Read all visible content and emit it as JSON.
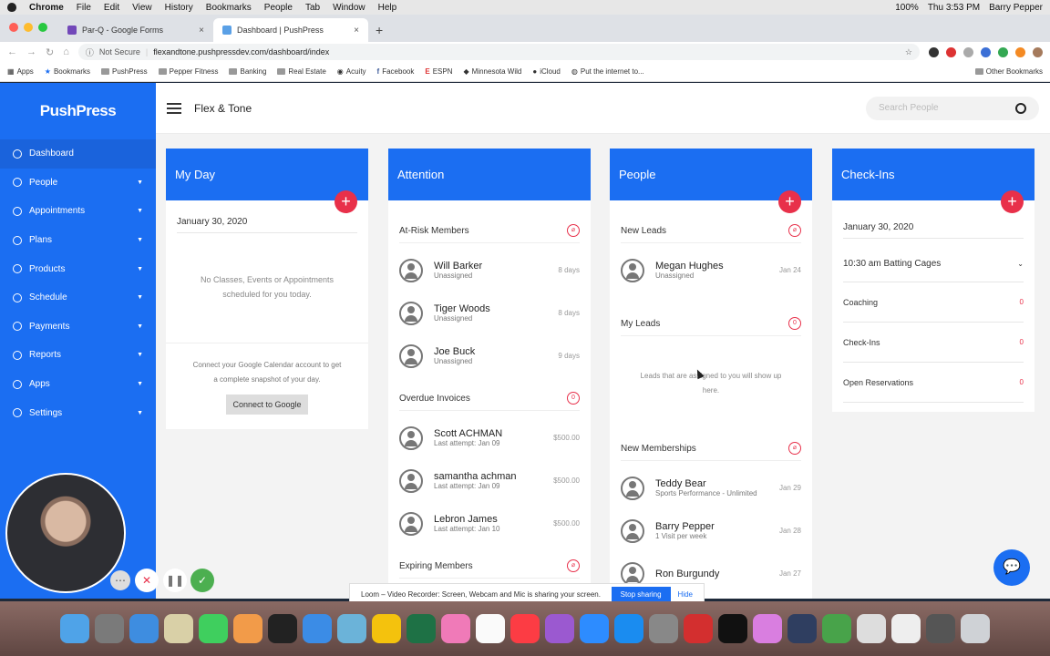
{
  "mac_menu": {
    "app": "Chrome",
    "items": [
      "File",
      "Edit",
      "View",
      "History",
      "Bookmarks",
      "People",
      "Tab",
      "Window",
      "Help"
    ],
    "battery": "100%",
    "clock": "Thu 3:53 PM",
    "user": "Barry Pepper"
  },
  "tabs": [
    {
      "label": "Par-Q - Google Forms"
    },
    {
      "label": "Dashboard | PushPress"
    }
  ],
  "address": {
    "security": "Not Secure",
    "url": "flexandtone.pushpressdev.com/dashboard/index"
  },
  "bookmarks": [
    "Apps",
    "Bookmarks",
    "PushPress",
    "Pepper Fitness",
    "Banking",
    "Real Estate",
    "Acuity",
    "Facebook",
    "ESPN",
    "Minnesota Wild",
    "iCloud",
    "Put the internet to...",
    "Other Bookmarks"
  ],
  "sidebar": {
    "logo": "PushPress",
    "items": [
      {
        "label": "Dashboard"
      },
      {
        "label": "People"
      },
      {
        "label": "Appointments"
      },
      {
        "label": "Plans"
      },
      {
        "label": "Products"
      },
      {
        "label": "Schedule"
      },
      {
        "label": "Payments"
      },
      {
        "label": "Reports"
      },
      {
        "label": "Apps"
      },
      {
        "label": "Settings"
      }
    ]
  },
  "topbar": {
    "gym": "Flex & Tone",
    "search_placeholder": "Search People"
  },
  "myday": {
    "title": "My Day",
    "date": "January 30, 2020",
    "empty_1": "No Classes, Events or Appointments",
    "empty_2": "scheduled for you today.",
    "google_1": "Connect your Google Calendar account to get",
    "google_2": "a complete snapshot of your day.",
    "google_btn": "Connect to Google"
  },
  "attention": {
    "title": "Attention",
    "atrisk_title": "At-Risk Members",
    "atrisk": [
      {
        "name": "Will Barker",
        "sub": "Unassigned",
        "val": "8 days"
      },
      {
        "name": "Tiger Woods",
        "sub": "Unassigned",
        "val": "8 days"
      },
      {
        "name": "Joe Buck",
        "sub": "Unassigned",
        "val": "9 days"
      }
    ],
    "overdue_title": "Overdue Invoices",
    "overdue_count": "0",
    "overdue": [
      {
        "name": "Scott ACHMAN",
        "sub": "Last attempt: Jan 09",
        "val": "$500.00"
      },
      {
        "name": "samantha achman",
        "sub": "Last attempt: Jan 09",
        "val": "$500.00"
      },
      {
        "name": "Lebron James",
        "sub": "Last attempt: Jan 10",
        "val": "$500.00"
      }
    ],
    "expiring_title": "Expiring Members"
  },
  "people": {
    "title": "People",
    "leads_title": "New Leads",
    "leads": [
      {
        "name": "Megan Hughes",
        "sub": "Unassigned",
        "val": "Jan 24"
      }
    ],
    "myleads_title": "My Leads",
    "myleads_count": "0",
    "myleads_empty_1": "Leads that are assigned to you will show up",
    "myleads_empty_2": "here.",
    "memberships_title": "New Memberships",
    "memberships": [
      {
        "name": "Teddy Bear",
        "sub": "Sports Performance - Unlimited",
        "val": "Jan 29"
      },
      {
        "name": "Barry Pepper",
        "sub": "1 Visit per week",
        "val": "Jan 28"
      },
      {
        "name": "Ron Burgundy",
        "sub": "",
        "val": "Jan 27"
      }
    ]
  },
  "checkins": {
    "title": "Check-Ins",
    "date": "January 30, 2020",
    "class": "10:30 am Batting Cages",
    "rows": [
      {
        "label": "Coaching",
        "val": "0"
      },
      {
        "label": "Check-Ins",
        "val": "0"
      },
      {
        "label": "Open Reservations",
        "val": "0"
      }
    ]
  },
  "loom": {
    "text": "Loom – Video Recorder: Screen, Webcam and Mic is sharing your screen.",
    "stop": "Stop sharing",
    "hide": "Hide"
  },
  "icons": {
    "chat": "chat-icon",
    "search": "search-icon",
    "plus": "plus-icon"
  },
  "colors": {
    "brand": "#1b6ef2",
    "accent": "#e8304a"
  }
}
